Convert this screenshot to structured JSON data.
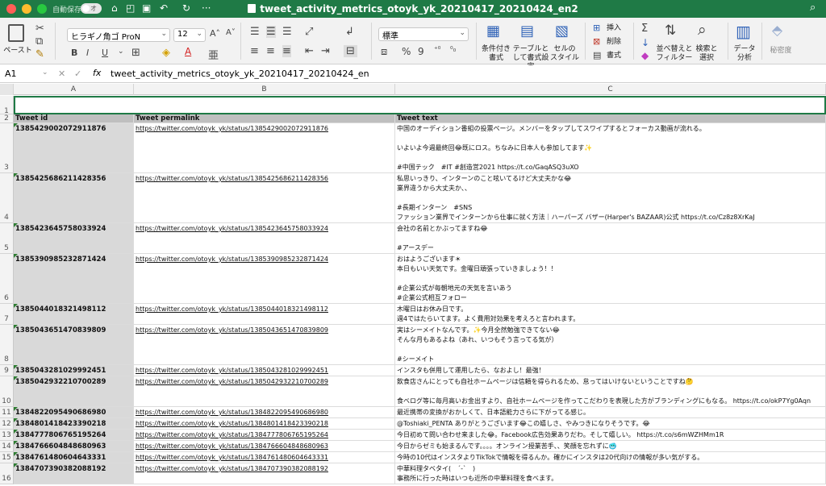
{
  "window": {
    "title": "tweet_activity_metrics_otoyk_yk_20210417_20210424_en2",
    "autosave_label": "自動保存",
    "autosave_state": "オフ"
  },
  "ribbon": {
    "paste_label": "ペースト",
    "font_name": "ヒラギノ角ゴ ProN",
    "font_size": "12",
    "number_format": "標準",
    "bold": "B",
    "italic": "I",
    "underline": "U",
    "cond_format": "条件付き\n書式",
    "table_format": "テーブルとして書式設定",
    "cell_style": "セルの\nスタイル",
    "insert": "挿入",
    "delete": "削除",
    "format": "書式",
    "sort_filter": "並べ替えと\nフィルター",
    "find_select": "検索と\n選択",
    "data_analysis": "データ\n分析",
    "confidentiality": "秘密度",
    "percent": "%",
    "comma": "9"
  },
  "formula_bar": {
    "cell_ref": "A1",
    "fx": "fx",
    "content": "tweet_activity_metrics_otoyk_yk_20210417_20210424_en"
  },
  "columns": [
    "A",
    "B",
    "C"
  ],
  "header": {
    "a": "Tweet id",
    "b": "Tweet permalink",
    "c": "Tweet text"
  },
  "rows": [
    {
      "num": "3",
      "id": "1385429002072911876",
      "link": "https://twitter.com/otoyk_yk/status/1385429002072911876",
      "text": [
        "中国のオーディション番組の投票ページ。メンバーをタップしてスワイプするとフォーカス動画が流れる。",
        "",
        "いよいよ今週最終回😂既にロス。ちなみに日本人も参加してます✨",
        "",
        "#中国テック　#IT #創造営2021 https://t.co/GaqASQ3uXO"
      ]
    },
    {
      "num": "4",
      "id": "1385425686211428356",
      "link": "https://twitter.com/otoyk_yk/status/1385425686211428356",
      "text": [
        "私思いっきり、インターンのこと呟いてるけど大丈夫かな😂",
        "業界違うから大丈夫か、、",
        "",
        "#長期インターン　#SNS",
        "ファッション業界でインターンから仕事に就く方法｜ハーパーズ バザー(Harper's BAZAAR)公式 https://t.co/Cz8z8XrKaJ"
      ]
    },
    {
      "num": "5",
      "id": "1385423645758033924",
      "link": "https://twitter.com/otoyk_yk/status/1385423645758033924",
      "text": [
        "会社の名前とかぶってますね😂",
        "",
        "#アースデー"
      ]
    },
    {
      "num": "6",
      "id": "1385390985232871424",
      "link": "https://twitter.com/otoyk_yk/status/1385390985232871424",
      "text": [
        "おはようございます☀",
        "本日もいい天気です。金曜日頑張っていきましょう！！",
        "",
        "#企業公式が毎朝地元の天気を言いあう",
        "#企業公式相互フォロー"
      ]
    },
    {
      "num": "7",
      "id": "1385044018321498112",
      "link": "https://twitter.com/otoyk_yk/status/1385044018321498112",
      "text": [
        "木曜日はお休み日です。",
        "週4ではたらいてます。よく費用対効果を考えろと言われます。"
      ]
    },
    {
      "num": "8",
      "id": "1385043651470839809",
      "link": "https://twitter.com/otoyk_yk/status/1385043651470839809",
      "text": [
        "実はシーメイトなんです。✨今月全然勉強できてない😂",
        "そんな月もあるよね（あれ、いつもそう言ってる気が）",
        "",
        "#シーメイト"
      ]
    },
    {
      "num": "9",
      "id": "1385043281029992451",
      "link": "https://twitter.com/otoyk_yk/status/1385043281029992451",
      "text": [
        "インスタも併用して運用したら、なおよし！最強！"
      ]
    },
    {
      "num": "10",
      "id": "1385042932210700289",
      "link": "https://twitter.com/otoyk_yk/status/1385042932210700289",
      "text": [
        "飲食店さんにとっても自社ホームページは信頼を得られるため、怠ってはいけないということですね🤔",
        "",
        "食べログ等に毎月高いお金出すより、自社ホームページを作ってこだわりを表現した方がブランディングにもなる。 https://t.co/okP7Yg0Aqn"
      ]
    },
    {
      "num": "11",
      "id": "1384822095490686980",
      "link": "https://twitter.com/otoyk_yk/status/1384822095490686980",
      "text": [
        "最近携帯の変換がおかしくて、日本語能力さらに下がってる感じ。"
      ]
    },
    {
      "num": "12",
      "id": "1384801418423390218",
      "link": "https://twitter.com/otoyk_yk/status/1384801418423390218",
      "text": [
        "@Toshiaki_PENTA ありがとうございます😂この嬉しさ、やみつきになりそうです。😂"
      ]
    },
    {
      "num": "13",
      "id": "1384777806765195264",
      "link": "https://twitter.com/otoyk_yk/status/1384777806765195264",
      "text": [
        "今日初めて問い合わせ来ました😂。Facebook広告効果ありだわ。そして嬉しい。 https://t.co/s6mWZHMm1R"
      ]
    },
    {
      "num": "14",
      "id": "1384766604848680963",
      "link": "https://twitter.com/otoyk_yk/status/1384766604848680963",
      "text": [
        "今日からゼミも始まるんです。。。。オンライン授業苦手、、笑顔を忘れずに🥶"
      ]
    },
    {
      "num": "15",
      "id": "1384761480604643331",
      "link": "https://twitter.com/otoyk_yk/status/1384761480604643331",
      "text": [
        "今時の10代はインスタよりTikTokで情報を得るんか。確かにインスタは20代向けの情報が多い気がする。"
      ]
    },
    {
      "num": "16",
      "id": "1384707390382088192",
      "link": "https://twitter.com/otoyk_yk/status/1384707390382088192",
      "text": [
        "中華料理タベタイ(　´-`　)",
        "事務所に行った時はいつも近所の中華料理を食べます。"
      ]
    }
  ]
}
